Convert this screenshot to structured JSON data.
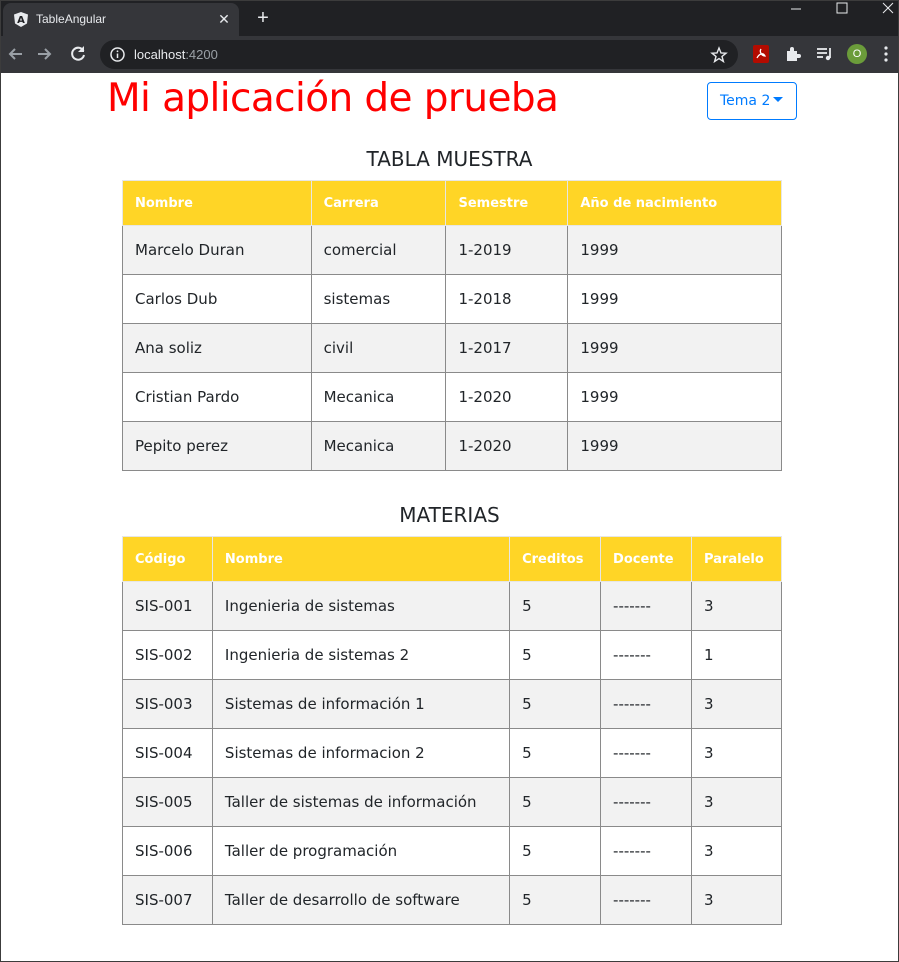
{
  "browser": {
    "tab_title": "TableAngular",
    "url_host": "localhost",
    "url_port": ":4200",
    "profile_initial": "O"
  },
  "header": {
    "title": "Mi aplicación de prueba",
    "theme_button": "Tema 2"
  },
  "students": {
    "title": "TABLA MUESTRA",
    "columns": [
      "Nombre",
      "Carrera",
      "Semestre",
      "Año de nacimiento"
    ],
    "rows": [
      [
        "Marcelo Duran",
        "comercial",
        "1-2019",
        "1999"
      ],
      [
        "Carlos Dub",
        "sistemas",
        "1-2018",
        "1999"
      ],
      [
        "Ana soliz",
        "civil",
        "1-2017",
        "1999"
      ],
      [
        "Cristian Pardo",
        "Mecanica",
        "1-2020",
        "1999"
      ],
      [
        "Pepito perez",
        "Mecanica",
        "1-2020",
        "1999"
      ]
    ]
  },
  "subjects": {
    "title": "MATERIAS",
    "columns": [
      "Código",
      "Nombre",
      "Creditos",
      "Docente",
      "Paralelo"
    ],
    "rows": [
      [
        "SIS-001",
        "Ingenieria de sistemas",
        "5",
        "-------",
        "3"
      ],
      [
        "SIS-002",
        "Ingenieria de sistemas 2",
        "5",
        "-------",
        "1"
      ],
      [
        "SIS-003",
        "Sistemas de información 1",
        "5",
        "-------",
        "3"
      ],
      [
        "SIS-004",
        "Sistemas de informacion 2",
        "5",
        "-------",
        "3"
      ],
      [
        "SIS-005",
        "Taller de sistemas de información",
        "5",
        "-------",
        "3"
      ],
      [
        "SIS-006",
        "Taller de programación",
        "5",
        "-------",
        "3"
      ],
      [
        "SIS-007",
        "Taller de desarrollo de software",
        "5",
        "-------",
        "3"
      ]
    ]
  },
  "colors": {
    "title_red": "#ff0000",
    "header_yellow": "#ffd526",
    "primary_blue": "#007bff"
  }
}
